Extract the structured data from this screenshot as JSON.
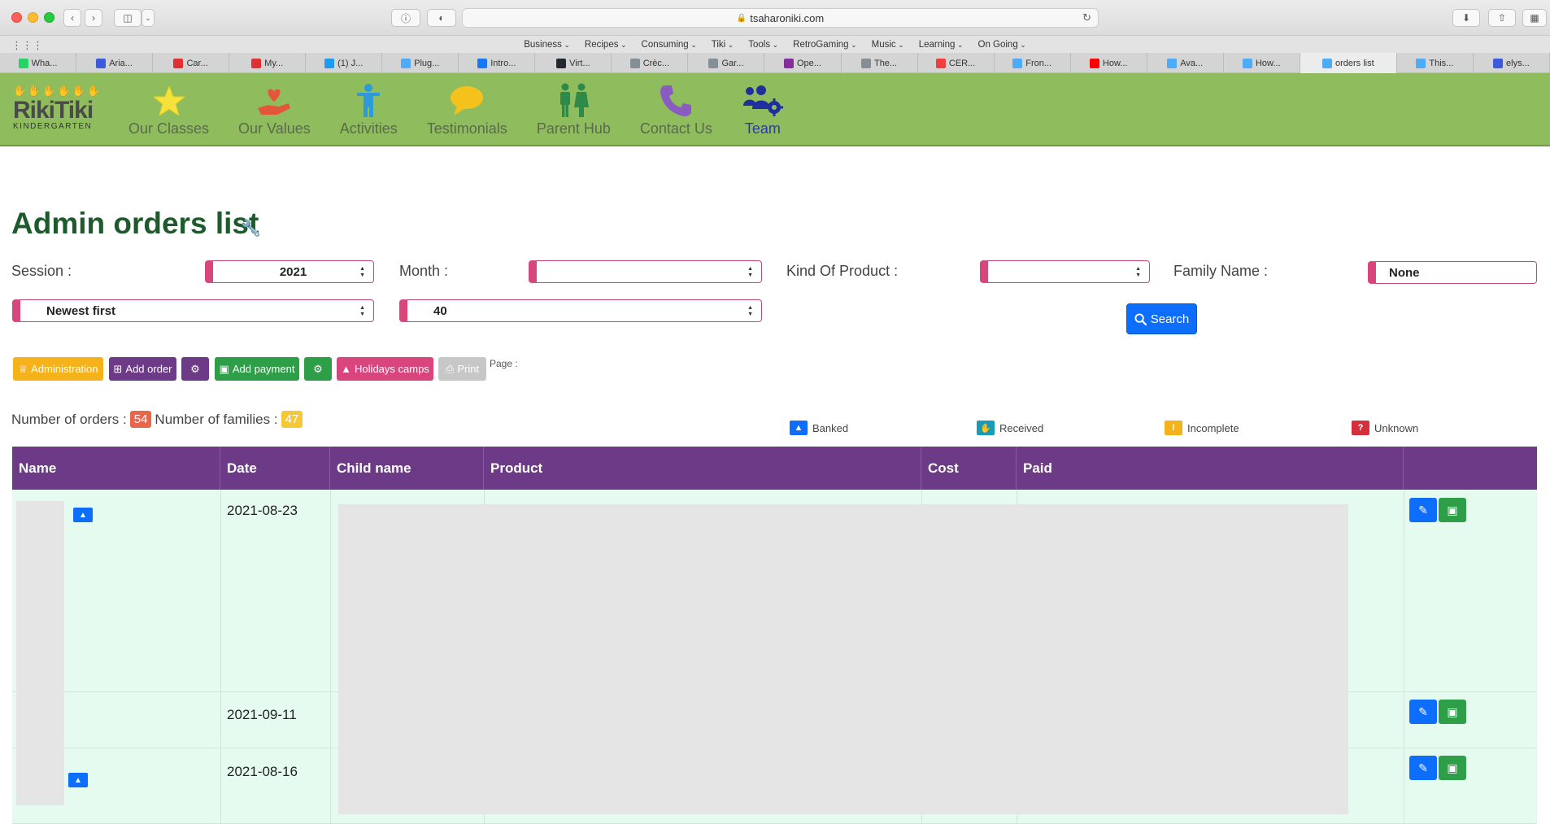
{
  "browser": {
    "url": "tsaharoniki.com",
    "bookmarks": [
      "Business",
      "Recipes",
      "Consuming",
      "Tiki",
      "Tools",
      "RetroGaming",
      "Music",
      "Learning",
      "On Going"
    ],
    "tabs": [
      {
        "label": "Wha...",
        "color": "#25d366"
      },
      {
        "label": "Aria...",
        "color": "#3b5bdb"
      },
      {
        "label": "Car...",
        "color": "#e03131"
      },
      {
        "label": "My...",
        "color": "#e03131"
      },
      {
        "label": "(1) J...",
        "color": "#1d9bf0"
      },
      {
        "label": "Plug...",
        "color": "#4dabf7"
      },
      {
        "label": "Intro...",
        "color": "#1877f2"
      },
      {
        "label": "Virt...",
        "color": "#24292f"
      },
      {
        "label": "Crèc...",
        "color": "#868e96"
      },
      {
        "label": "Gar...",
        "color": "#868e96"
      },
      {
        "label": "Ope...",
        "color": "#862e9c"
      },
      {
        "label": "The...",
        "color": "#868e96"
      },
      {
        "label": "CER...",
        "color": "#f03e3e"
      },
      {
        "label": "Fron...",
        "color": "#4dabf7"
      },
      {
        "label": "How...",
        "color": "#ff0000"
      },
      {
        "label": "Ava...",
        "color": "#4dabf7"
      },
      {
        "label": "How...",
        "color": "#4dabf7"
      },
      {
        "label": "orders list",
        "color": "#4dabf7",
        "active": true
      },
      {
        "label": "This...",
        "color": "#4dabf7"
      },
      {
        "label": "elys...",
        "color": "#3b5bdb"
      }
    ]
  },
  "site": {
    "logo_title": "RikiTiki",
    "logo_sub": "KINDERGARTEN",
    "nav": [
      {
        "label": "Our Classes",
        "icon": "star-icon"
      },
      {
        "label": "Our Values",
        "icon": "heart-hand-icon"
      },
      {
        "label": "Activities",
        "icon": "child-icon"
      },
      {
        "label": "Testimonials",
        "icon": "speech-bubble-icon"
      },
      {
        "label": "Parent Hub",
        "icon": "parents-icon"
      },
      {
        "label": "Contact Us",
        "icon": "phone-icon"
      },
      {
        "label": "Team",
        "icon": "users-gear-icon"
      }
    ]
  },
  "page": {
    "title": "Admin orders list",
    "filters": {
      "session_label": "Session :",
      "session_value": "2021",
      "month_label": "Month :",
      "month_value": "",
      "kind_label": "Kind Of Product :",
      "kind_value": "",
      "family_label": "Family Name :",
      "family_value": "None",
      "sort_value": "Newest first",
      "perpage_value": "40",
      "search_label": "Search"
    },
    "actions": {
      "administration": "Administration",
      "add_order": "Add order",
      "add_payment": "Add payment",
      "holidays_camps": "Holidays camps",
      "print": "Print",
      "page_label": "Page :"
    },
    "counts": {
      "orders_label": "Number of orders :",
      "orders_value": "54",
      "families_label": "Number of families :",
      "families_value": "47"
    },
    "legend": {
      "banked": "Banked",
      "received": "Received",
      "incomplete": "Incomplete",
      "unknown": "Unknown"
    },
    "table": {
      "headers": [
        "Name",
        "Date",
        "Child name",
        "Product",
        "Cost",
        "Paid"
      ],
      "rows": [
        {
          "date": "2021-08-23"
        },
        {
          "date": "2021-09-11"
        },
        {
          "date": "2021-08-16"
        }
      ]
    }
  },
  "colors": {
    "header_green": "#8fbd5e",
    "table_purple": "#6c3a87",
    "row_mint": "#e6fbef",
    "accent_pink": "#d9467e",
    "primary_blue": "#0d6efd"
  }
}
